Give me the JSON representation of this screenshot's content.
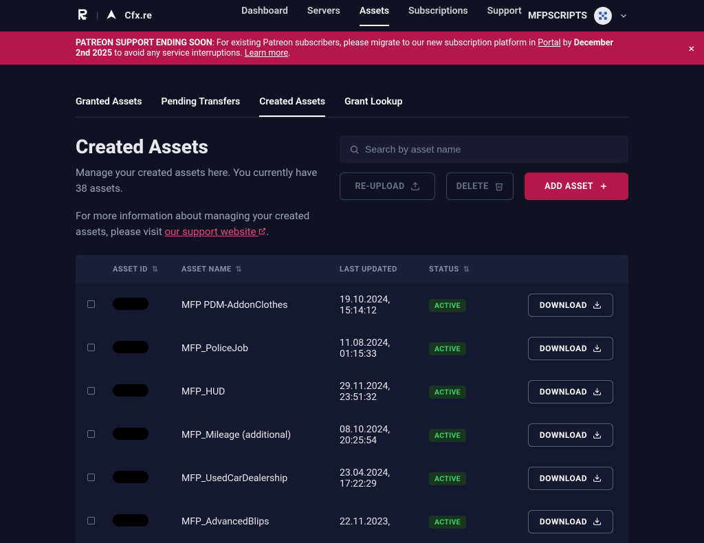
{
  "header": {
    "brand": "Cfx.re",
    "nav": [
      "Dashboard",
      "Servers",
      "Assets",
      "Subscriptions",
      "Support"
    ],
    "nav_active": 2,
    "username": "MFPSCRIPTS"
  },
  "banner": {
    "prefix": "PATREON SUPPORT ENDING SOON",
    "mid1": ": For existing Patreon subscribers, please migrate to our new subscription platform in ",
    "portal": "Portal",
    "mid2": " by ",
    "date": "December 2nd 2025",
    "mid3": " to avoid any service interruptions. ",
    "learn": "Learn more",
    "tail": "."
  },
  "subtabs": {
    "items": [
      "Granted Assets",
      "Pending Transfers",
      "Created Assets",
      "Grant Lookup"
    ],
    "active": 2
  },
  "page": {
    "title": "Created Assets",
    "sub1": "Manage your created assets here. You currently have 38 assets.",
    "sub2a": "For more information about managing your created assets, please visit ",
    "sub2link": "our support website",
    "sub2b": "."
  },
  "search": {
    "placeholder": "Search by asset name"
  },
  "buttons": {
    "reupload": "RE-UPLOAD",
    "delete": "DELETE",
    "add": "ADD ASSET",
    "download": "DOWNLOAD"
  },
  "table": {
    "headers": {
      "asset_id": "ASSET ID",
      "asset_name": "ASSET NAME",
      "last_updated": "LAST UPDATED",
      "status": "STATUS"
    },
    "rows": [
      {
        "name": "MFP PDM-AddonClothes",
        "date": "19.10.2024, 15:14:12",
        "status": "ACTIVE"
      },
      {
        "name": "MFP_PoliceJob",
        "date": "11.08.2024, 01:15:33",
        "status": "ACTIVE"
      },
      {
        "name": "MFP_HUD",
        "date": "29.11.2024, 23:51:32",
        "status": "ACTIVE"
      },
      {
        "name": "MFP_Mileage (additional)",
        "date": "08.10.2024, 20:25:54",
        "status": "ACTIVE"
      },
      {
        "name": "MFP_UsedCarDealership",
        "date": "23.04.2024, 17:22:29",
        "status": "ACTIVE"
      },
      {
        "name": "MFP_AdvancedBlips",
        "date": "22.11.2023,",
        "status": "ACTIVE"
      }
    ]
  }
}
